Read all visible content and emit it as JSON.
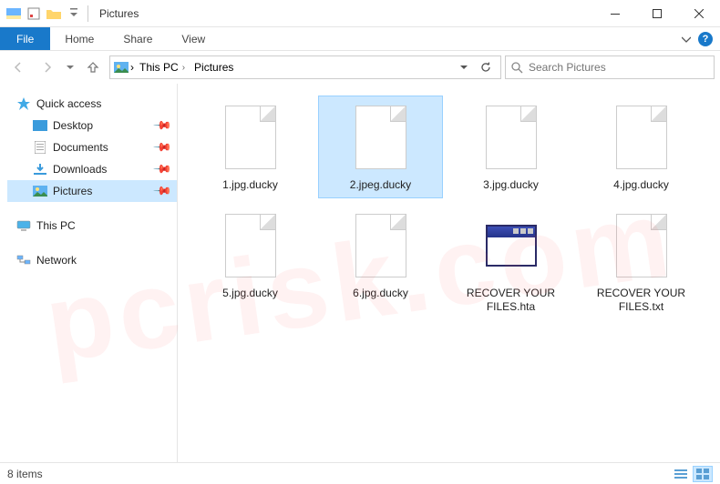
{
  "window": {
    "title": "Pictures"
  },
  "ribbon": {
    "file": "File",
    "tabs": [
      "Home",
      "Share",
      "View"
    ]
  },
  "breadcrumb": {
    "items": [
      "This PC",
      "Pictures"
    ]
  },
  "search": {
    "placeholder": "Search Pictures"
  },
  "navpane": {
    "quick_access": "Quick access",
    "quick_items": [
      {
        "label": "Desktop",
        "icon": "desktop"
      },
      {
        "label": "Documents",
        "icon": "documents"
      },
      {
        "label": "Downloads",
        "icon": "downloads"
      },
      {
        "label": "Pictures",
        "icon": "pictures",
        "selected": true
      }
    ],
    "this_pc": "This PC",
    "network": "Network"
  },
  "files": [
    {
      "name": "1.jpg.ducky",
      "type": "blank",
      "selected": false
    },
    {
      "name": "2.jpeg.ducky",
      "type": "blank",
      "selected": true
    },
    {
      "name": "3.jpg.ducky",
      "type": "blank",
      "selected": false
    },
    {
      "name": "4.jpg.ducky",
      "type": "blank",
      "selected": false
    },
    {
      "name": "5.jpg.ducky",
      "type": "blank",
      "selected": false
    },
    {
      "name": "6.jpg.ducky",
      "type": "blank",
      "selected": false
    },
    {
      "name": "RECOVER YOUR FILES.hta",
      "type": "hta",
      "selected": false
    },
    {
      "name": "RECOVER YOUR FILES.txt",
      "type": "blank",
      "selected": false
    }
  ],
  "status": {
    "count_text": "8 items"
  },
  "watermark": "pcrisk.com"
}
